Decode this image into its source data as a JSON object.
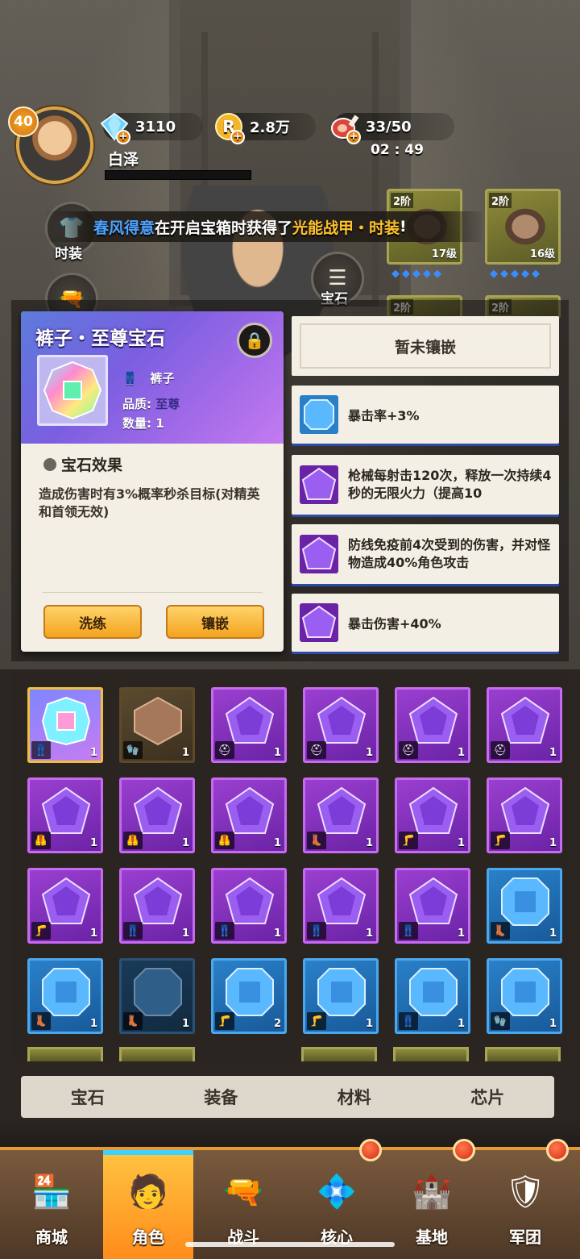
{
  "player": {
    "level": "40",
    "name": "白泽",
    "exp_fraction": 0.0
  },
  "resources": {
    "diamonds": "3110",
    "coins": "2.8万",
    "stamina": "33/50",
    "timer": "02 : 49"
  },
  "side_buttons": {
    "fashion_label": "时装",
    "gem_label": "宝石"
  },
  "marquee": {
    "player": "春风得意",
    "middle": "在开启宝箱时获得了",
    "item": "光能战甲・时装",
    "end": "!"
  },
  "equipment": [
    {
      "tier": "2阶",
      "level": "17级"
    },
    {
      "tier": "2阶",
      "level": "16级"
    },
    {
      "tier": "2阶"
    },
    {
      "tier": "2阶"
    }
  ],
  "detail": {
    "title": "裤子・至尊宝石",
    "slot": "裤子",
    "quality_label": "品质:",
    "quality_value": "至尊",
    "quantity_label": "数量:",
    "quantity_value": "1",
    "effect_title": "宝石效果",
    "effect_desc": "造成伤害时有3%概率秒杀目标(对精英和首领无效)",
    "refine_label": "洗练",
    "inlay_label": "镶嵌"
  },
  "effects": {
    "empty": "暂未镶嵌",
    "items": [
      {
        "text": "暴击率+3%",
        "color": "blue"
      },
      {
        "text": "枪械每射击120次，释放一次持续4秒的无限火力（提高10",
        "color": "purple"
      },
      {
        "text": "防线免疫前4次受到的伤害，并对怪物造成40%角色攻击",
        "color": "purple"
      },
      {
        "text": "暴击伤害+40%",
        "color": "purple"
      }
    ]
  },
  "inventory": [
    {
      "type": "rainbow",
      "slot": "pants",
      "count": "1"
    },
    {
      "type": "bronze",
      "slot": "glove",
      "count": "1"
    },
    {
      "type": "purple",
      "slot": "helmet",
      "count": "1"
    },
    {
      "type": "purple",
      "slot": "helmet",
      "count": "1"
    },
    {
      "type": "purple",
      "slot": "helmet",
      "count": "1"
    },
    {
      "type": "purple",
      "slot": "helmet",
      "count": "1"
    },
    {
      "type": "purple",
      "slot": "armor",
      "count": "1"
    },
    {
      "type": "purple",
      "slot": "armor",
      "count": "1"
    },
    {
      "type": "purple",
      "slot": "armor",
      "count": "1"
    },
    {
      "type": "purple",
      "slot": "boot",
      "count": "1"
    },
    {
      "type": "purple",
      "slot": "knee",
      "count": "1"
    },
    {
      "type": "purple",
      "slot": "knee",
      "count": "1"
    },
    {
      "type": "purple",
      "slot": "knee",
      "count": "1"
    },
    {
      "type": "purple",
      "slot": "pants",
      "count": "1"
    },
    {
      "type": "purple",
      "slot": "pants",
      "count": "1"
    },
    {
      "type": "purple",
      "slot": "pants",
      "count": "1"
    },
    {
      "type": "purple",
      "slot": "pants",
      "count": "1"
    },
    {
      "type": "blue",
      "slot": "boot",
      "count": "1"
    },
    {
      "type": "blue",
      "slot": "boot",
      "count": "1"
    },
    {
      "type": "blue-dim",
      "slot": "boot",
      "count": "1"
    },
    {
      "type": "blue",
      "slot": "knee",
      "count": "2"
    },
    {
      "type": "blue",
      "slot": "knee",
      "count": "1"
    },
    {
      "type": "blue",
      "slot": "pants",
      "count": "1"
    },
    {
      "type": "blue",
      "slot": "glove",
      "count": "1"
    }
  ],
  "tabs": [
    "宝石",
    "装备",
    "材料",
    "芯片"
  ],
  "active_tab": 0,
  "nav": [
    {
      "label": "商城",
      "icon": "shop-icon"
    },
    {
      "label": "角色",
      "icon": "character-icon"
    },
    {
      "label": "战斗",
      "icon": "battle-icon"
    },
    {
      "label": "核心",
      "icon": "core-icon"
    },
    {
      "label": "基地",
      "icon": "base-icon"
    },
    {
      "label": "军团",
      "icon": "legion-icon"
    }
  ],
  "colors": {
    "accent_orange": "#f3a31f",
    "purple_gem": "#7a35c4",
    "blue_gem": "#2a80c8",
    "marquee_player": "#4ea3ff",
    "marquee_item": "#ffc12a"
  }
}
